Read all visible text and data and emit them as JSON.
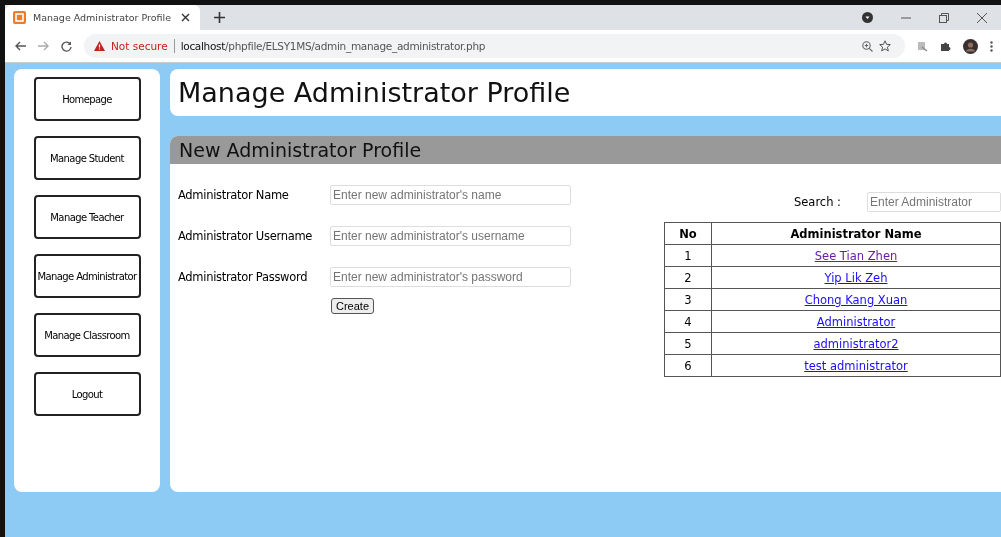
{
  "browser": {
    "tab_title": "Manage Administrator Profile",
    "security": "Not secure",
    "url_host": "localhost",
    "url_path": "/phpfile/ELSY1MS/admin_manage_administrator.php"
  },
  "sidebar": {
    "items": [
      {
        "label": "Homepage"
      },
      {
        "label": "Manage Student"
      },
      {
        "label": "Manage Teacher"
      },
      {
        "label": "Manage Administrator"
      },
      {
        "label": "Manage Classroom"
      },
      {
        "label": "Logout"
      }
    ]
  },
  "page_title": "Manage Administrator Profile",
  "form": {
    "title": "New Administrator Profile",
    "fields": [
      {
        "label": "Administrator Name",
        "placeholder": "Enter new administrator's name"
      },
      {
        "label": "Administrator Username",
        "placeholder": "Enter new administrator's username"
      },
      {
        "label": "Administrator Password",
        "placeholder": "Enter new administrator's password"
      }
    ],
    "submit": "Create"
  },
  "search": {
    "label": "Search :",
    "placeholder": "Enter Administrator"
  },
  "table": {
    "columns": [
      "No",
      "Administrator Name"
    ],
    "rows": [
      {
        "no": "1",
        "name": "See Tian Zhen",
        "visited": true
      },
      {
        "no": "2",
        "name": "Yip Lik Zeh",
        "visited": false
      },
      {
        "no": "3",
        "name": "Chong Kang Xuan",
        "visited": false
      },
      {
        "no": "4",
        "name": "Administrator",
        "visited": false
      },
      {
        "no": "5",
        "name": "administrator2",
        "visited": false
      },
      {
        "no": "6",
        "name": "test administrator",
        "visited": false
      }
    ]
  }
}
